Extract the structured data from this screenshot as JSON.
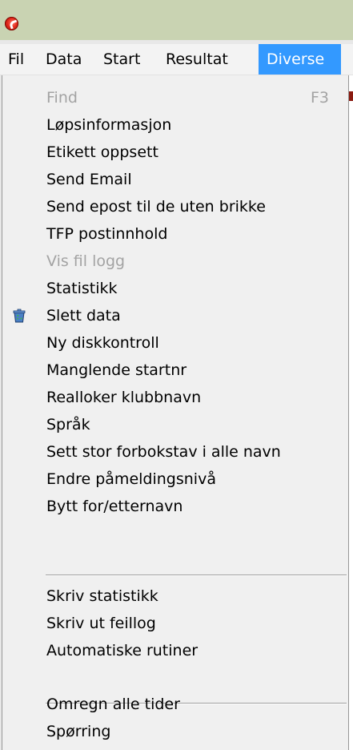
{
  "menubar": {
    "items": [
      {
        "label": "Fil"
      },
      {
        "label": "Data"
      },
      {
        "label": "Start"
      },
      {
        "label": "Resultat"
      },
      {
        "label": "Diverse"
      }
    ]
  },
  "colors": {
    "titlebar": "#c9d3b2",
    "menu_highlight": "#3399ff",
    "menu_bg": "#f0f0f0",
    "disabled_text": "#a3a3a3"
  },
  "dropdown": {
    "items": [
      {
        "label": "Find",
        "shortcut": "F3",
        "enabled": false
      },
      {
        "label": "Løpsinformasjon",
        "enabled": true
      },
      {
        "label": "Etikett oppsett",
        "enabled": true
      },
      {
        "label": "Send Email",
        "enabled": true
      },
      {
        "label": "Send epost til de uten brikke",
        "enabled": true
      },
      {
        "label": "TFP postinnhold",
        "enabled": true
      },
      {
        "label": "Vis fil logg",
        "enabled": false
      },
      {
        "label": "Statistikk",
        "enabled": true
      },
      {
        "label": "Slett data",
        "enabled": true,
        "icon": "recycle-bin-icon"
      },
      {
        "label": "Ny diskkontroll",
        "enabled": true
      },
      {
        "label": "Manglende startnr",
        "enabled": true
      },
      {
        "label": "Realloker klubbnavn",
        "enabled": true
      },
      {
        "label": "Språk",
        "enabled": true
      },
      {
        "label": "Sett stor forbokstav i alle navn",
        "enabled": true
      },
      {
        "label": "Endre påmeldingsnivå",
        "enabled": true
      },
      {
        "label": "Bytt for/etternavn",
        "enabled": true
      },
      {
        "label": "Skriv statistikk",
        "enabled": true
      },
      {
        "label": "Skriv ut feillog",
        "enabled": true
      },
      {
        "label": "Automatiske rutiner",
        "enabled": true
      },
      {
        "label": "Omregn alle tider",
        "enabled": true
      },
      {
        "label": "Spørring",
        "enabled": true
      }
    ]
  }
}
